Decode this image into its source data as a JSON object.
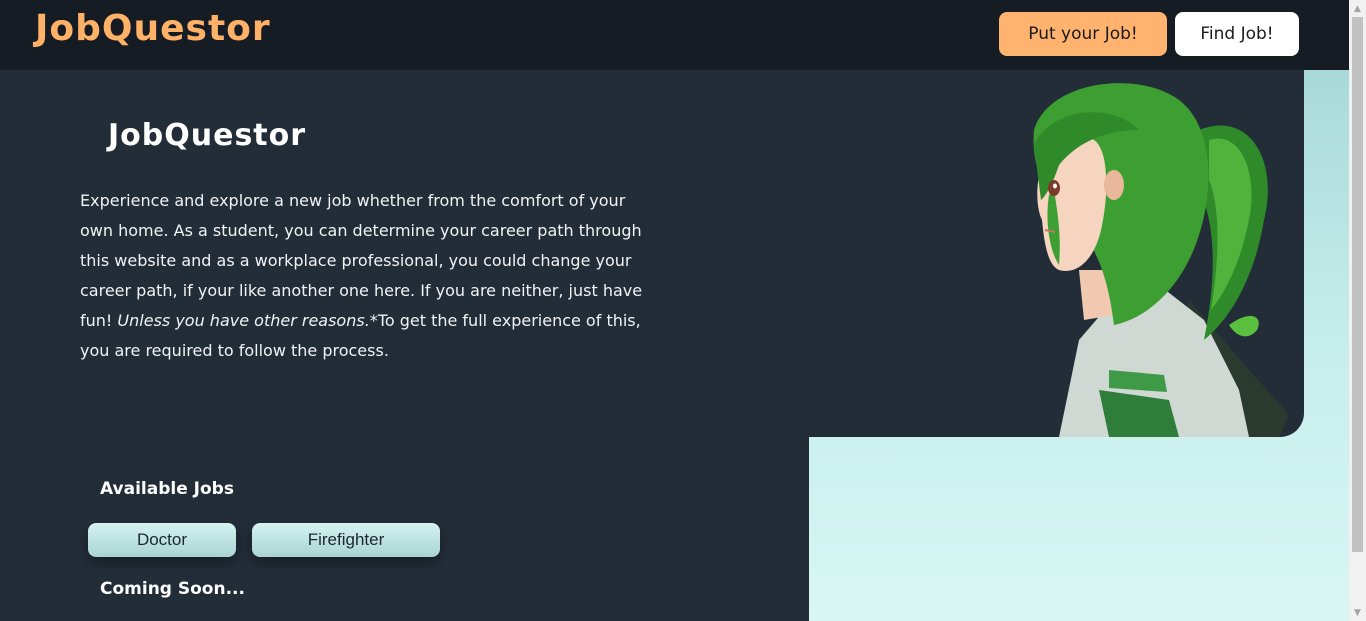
{
  "header": {
    "brand": "JobQuestor",
    "put_job_label": "Put your Job!",
    "find_job_label": "Find Job!"
  },
  "main": {
    "title": "JobQuestor",
    "intro_before_italic": "Experience and explore a new job whether from the comfort of your own home. As a student, you can determine your career path through this website and as a workplace professional, you could change your career path, if your like another one here. If you are neither, just have fun! ",
    "intro_italic": "Unless you have other reasons.",
    "intro_after_italic": "*To get the full experience of this, you are required to follow the process."
  },
  "jobs": {
    "section_title": "Available Jobs",
    "items": [
      "Doctor",
      "Firefighter"
    ],
    "coming_soon": "Coming Soon..."
  },
  "colors": {
    "accent": "#ffb36e",
    "brand": "#ffb168",
    "background": "#232d38",
    "header": "#161c23",
    "aqua": "#c6eeeb"
  },
  "icons": {
    "scroll_up": "triangle-up",
    "scroll_down": "triangle-down"
  }
}
